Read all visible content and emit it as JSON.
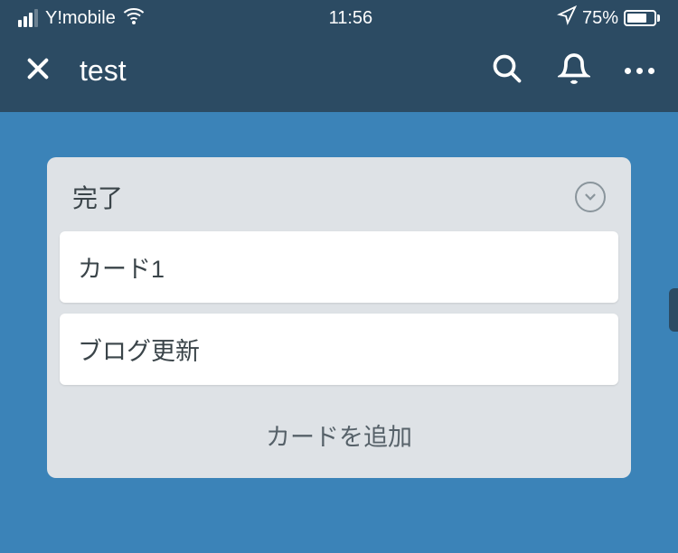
{
  "status_bar": {
    "carrier": "Y!mobile",
    "time": "11:56",
    "battery_percent": "75%"
  },
  "header": {
    "board_title": "test"
  },
  "list": {
    "title": "完了",
    "cards": [
      {
        "title": "カード1"
      },
      {
        "title": "ブログ更新"
      }
    ],
    "add_card_label": "カードを追加"
  }
}
